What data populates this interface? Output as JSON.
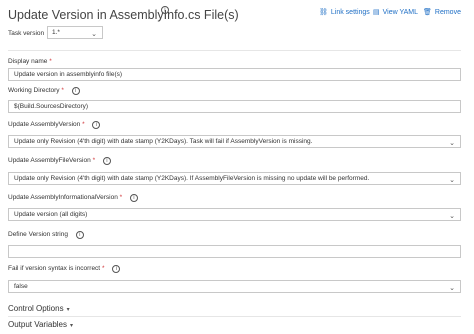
{
  "task": {
    "title": "Update Version in AssemblyInfo.cs File(s)"
  },
  "toolbar": {
    "link_settings": "Link settings",
    "view_yaml": "View YAML",
    "remove": "Remove"
  },
  "task_version": {
    "label": "Task version",
    "value": "1.*"
  },
  "fields": {
    "display_name": {
      "label": "Display name",
      "required": "*",
      "value": "Update version in assemblyinfo file(s)"
    },
    "working_directory": {
      "label": "Working Directory",
      "required": "*",
      "value": "$(Build.SourcesDirectory)"
    },
    "update_assembly_version": {
      "label": "Update AssemblyVersion",
      "required": "*",
      "value": "Update only Revision (4'th digit) with date stamp (Y2KDays). Task will fail if AssemblyVersion is missing."
    },
    "update_assembly_file_version": {
      "label": "Update AssemblyFileVersion",
      "required": "*",
      "value": "Update only Revision (4'th digit) with date stamp (Y2KDays). If AssemblyFileVersion is missing no update will be performed."
    },
    "update_assembly_informational_version": {
      "label": "Update AssemblyInformationalVersion",
      "required": "*",
      "value": "Update version (all digits)"
    },
    "define_version_string": {
      "label": "Define Version string",
      "value": ""
    },
    "fail_if_syntax_incorrect": {
      "label": "Fail if version syntax is incorrect",
      "required": "*",
      "value": "false"
    }
  },
  "sections": {
    "control_options": "Control Options",
    "output_variables": "Output Variables"
  },
  "colors": {
    "link": "#1f6fc5",
    "required": "#d13438",
    "border": "#c8c8c8"
  },
  "icons": {
    "link_settings": "link-icon",
    "view_yaml": "document-icon",
    "remove": "trash-icon",
    "info": "info-icon",
    "dropdown": "chevron-down-icon"
  }
}
